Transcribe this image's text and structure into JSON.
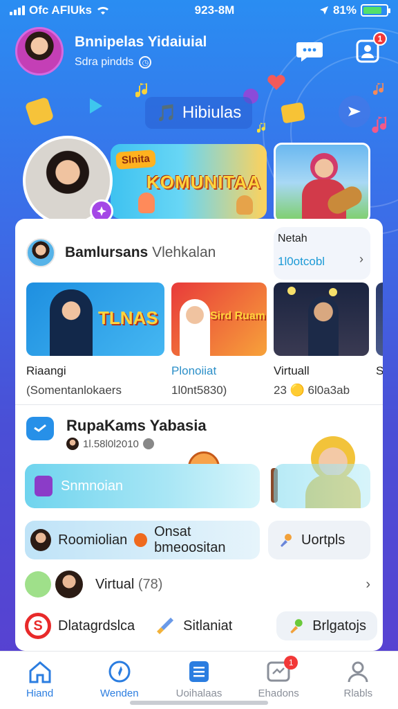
{
  "status_bar": {
    "carrier": "Ofc AFlUks",
    "time": "923-8M",
    "battery": "81%",
    "battery_level": 0.81,
    "battery_color": "#53e06a"
  },
  "header": {
    "name": "Bnnipelas Yidaiuial",
    "subtitle": "Sdra pindds",
    "notification_count": "1",
    "icons": [
      "chat-bubble-icon",
      "profile-card-icon"
    ]
  },
  "hero": {
    "pill_glyph": "🎵",
    "pill_label": "Hibiulas"
  },
  "banner": {
    "tag": "Slnita",
    "title": "KOMUNITAA"
  },
  "featured": {
    "section_title_bold": "Bamlursans",
    "section_title_rest": "Vlehkalan",
    "promo_line1": "Netah",
    "promo_line2": "1l0otcobl",
    "thumbs": [
      {
        "title": "Riaangi",
        "sub": "(Somentanlokaers",
        "overlay": "TLNAS"
      },
      {
        "title": "Plonoiiat",
        "sub": "1l0nt5830)",
        "overlay": "Sird Ruam"
      },
      {
        "title": "Virtuall",
        "sub": "23 🟡 6l0a3ab",
        "overlay": ""
      },
      {
        "title": "S",
        "sub": "",
        "overlay": ""
      }
    ]
  },
  "community": {
    "title": "RupaKams Yabasia",
    "meta": "1l.58l0l2010",
    "pill_label": "Snmnoian",
    "row_a_label": "Roomiolian",
    "row_a_label2": "Onsat bmeoositan",
    "row_b_label": "Uortpls",
    "list_label": "Virtual",
    "list_count": "(78)",
    "bottom_items": [
      "Dlatagrdslca",
      "Sitlaniat",
      "Brlgatojs"
    ]
  },
  "tabbar": {
    "tabs": [
      {
        "label": "Hiand",
        "icon": "home-icon",
        "active": true
      },
      {
        "label": "Wenden",
        "icon": "compass-icon",
        "active": true
      },
      {
        "label": "Uoihalaas",
        "icon": "list-icon",
        "active": false
      },
      {
        "label": "Ehadons",
        "icon": "inbox-icon",
        "active": false,
        "badge": "1"
      },
      {
        "label": "Rlabls",
        "icon": "person-icon",
        "active": false
      }
    ]
  },
  "colors": {
    "accent": "#2b7de0",
    "badge": "#f23838",
    "purple": "#a447e6"
  }
}
